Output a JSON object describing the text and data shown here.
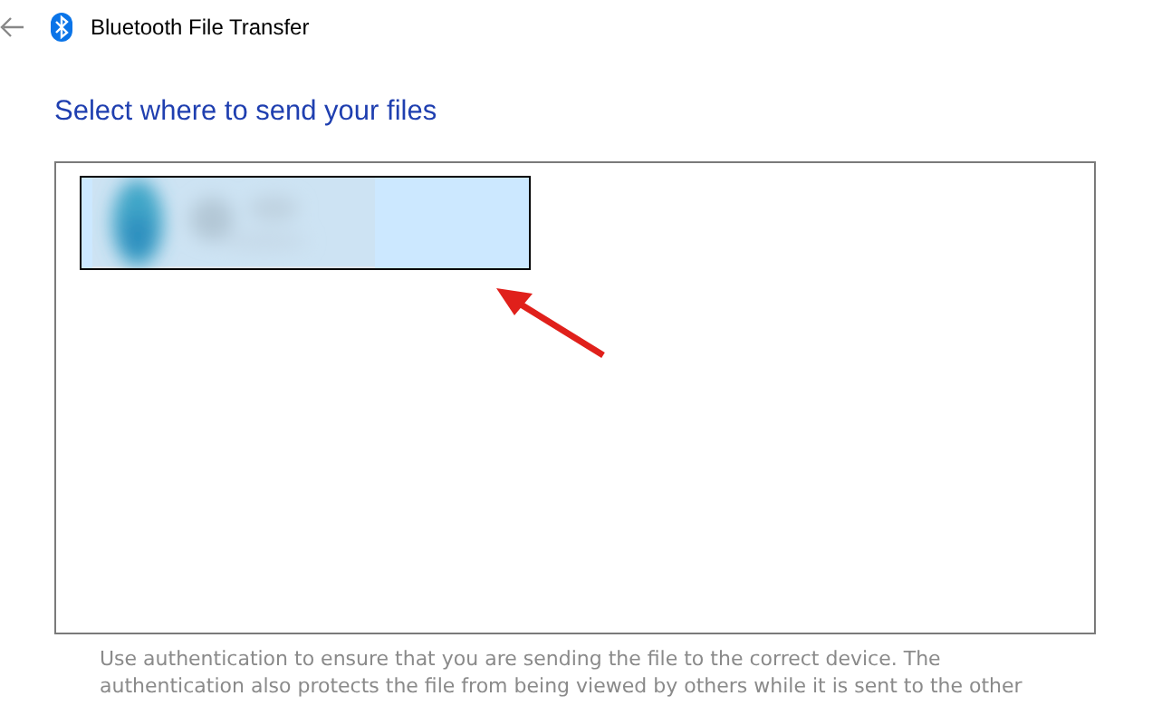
{
  "window": {
    "title": "Bluetooth File Transfer"
  },
  "heading": "Select where to send your files",
  "devices": [
    {
      "kind": "picture",
      "selected": true
    }
  ],
  "note": "Use authentication to ensure that you are sending the file to the correct device. The authentication also protects the file from being viewed by others while it is sent to the other"
}
